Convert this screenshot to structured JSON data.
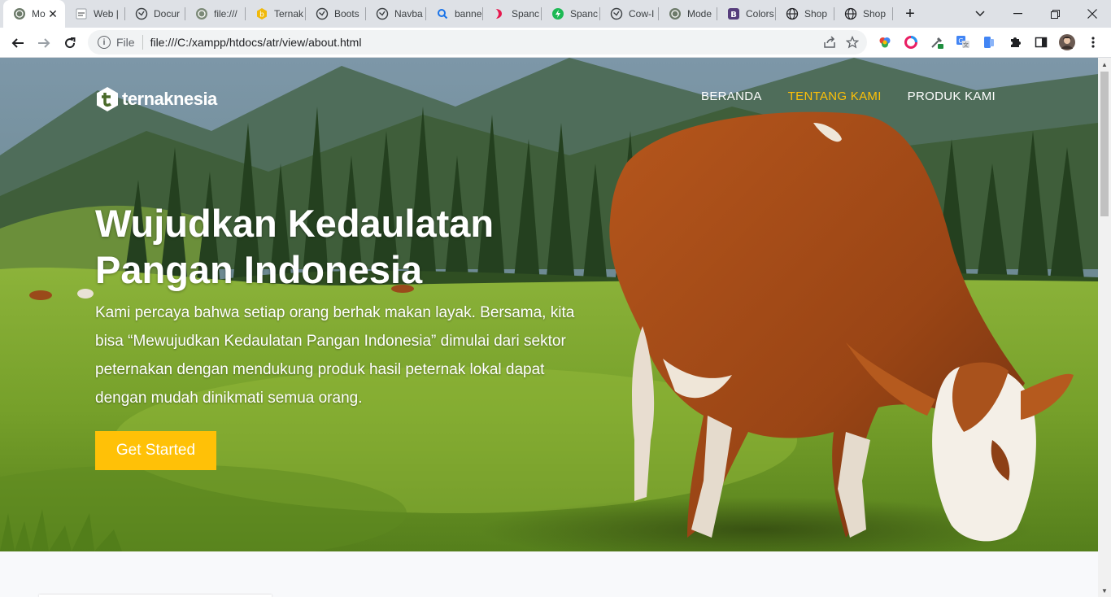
{
  "browser": {
    "tabs": [
      {
        "label": "Mo",
        "icon": "site-globe-icon",
        "active": true
      },
      {
        "label": "Web |",
        "icon": "document-icon"
      },
      {
        "label": "Docur",
        "icon": "globe-icon"
      },
      {
        "label": "file:///",
        "icon": "site-globe-icon"
      },
      {
        "label": "Ternak",
        "icon": "bitcoin-icon"
      },
      {
        "label": "Boots",
        "icon": "globe-icon"
      },
      {
        "label": "Navba",
        "icon": "globe-icon"
      },
      {
        "label": "banne",
        "icon": "search-icon"
      },
      {
        "label": "Spanc",
        "icon": "bitbucket-icon"
      },
      {
        "label": "Spanc",
        "icon": "bolt-icon"
      },
      {
        "label": "Cow-I",
        "icon": "globe-icon"
      },
      {
        "label": "Mode",
        "icon": "site-globe-icon"
      },
      {
        "label": "Colors",
        "icon": "bootstrap-icon"
      },
      {
        "label": "Shop",
        "icon": "globe-icon"
      },
      {
        "label": "Shop",
        "icon": "globe-icon"
      }
    ],
    "address": {
      "scheme": "File",
      "url": "file:///C:/xampp/htdocs/atr/view/about.html"
    }
  },
  "page": {
    "brand": "ternaknesia",
    "nav": [
      {
        "label": "BERANDA",
        "current": false
      },
      {
        "label": "TENTANG KAMI",
        "current": true
      },
      {
        "label": "PRODUK KAMI",
        "current": false
      }
    ],
    "hero": {
      "headline_line1": "Wujudkan Kedaulatan",
      "headline_line2": "Pangan Indonesia",
      "lead": "Kami percaya bahwa setiap orang berhak makan layak. Bersama, kita bisa “Mewujudkan Kedaulatan Pangan Indonesia” dimulai dari sektor peternakan dengan mendukung produk hasil peternak lokal dapat dengan mudah dinikmati semua orang.",
      "cta": "Get Started"
    }
  },
  "colors": {
    "accent": "#ffc107",
    "nav_text": "#ffffff"
  }
}
